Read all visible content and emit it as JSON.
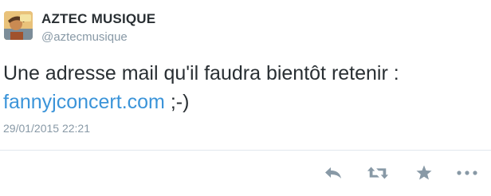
{
  "tweet": {
    "author_name": "AZTEC MUSIQUE",
    "author_handle": "@aztecmusique",
    "text_before_link": "Une adresse mail qu'il faudra bientôt retenir : ",
    "link_text": "fannyjconcert.com",
    "text_after_link": " ;-)",
    "timestamp": "29/01/2015 22:21"
  },
  "actions": [
    {
      "icon": "reply-icon"
    },
    {
      "icon": "retweet-icon"
    },
    {
      "icon": "favorite-star-icon"
    },
    {
      "icon": "more-icon"
    }
  ],
  "colors": {
    "link": "#3b94d9",
    "text": "#292f33",
    "muted": "#8899a6",
    "icon": "#8899a6"
  }
}
